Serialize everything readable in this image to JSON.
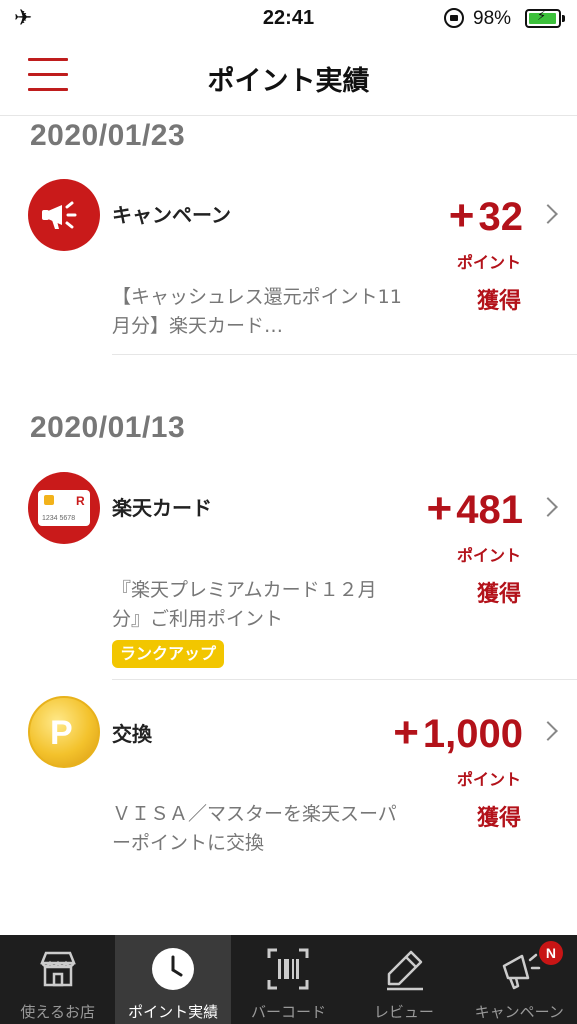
{
  "status_bar": {
    "time": "22:41",
    "battery_percent": "98%",
    "battery_level": 0.98,
    "icons": [
      "airplane-icon",
      "orientation-lock-icon",
      "battery-charging-icon"
    ]
  },
  "header": {
    "title": "ポイント実績",
    "menu_icon": "hamburger-icon"
  },
  "colors": {
    "accent_red": "#bf1d1d",
    "points_red": "#b3121a",
    "badge_yellow": "#f2c600",
    "tab_bar_bg": "#1e1e1e"
  },
  "groups": [
    {
      "date": "2020/01/23",
      "entries": [
        {
          "icon": "megaphone-icon",
          "category": "キャンペーン",
          "amount": "32",
          "plus": "+",
          "points_label": "ポイント",
          "status": "獲得",
          "description": "【キャッシュレス還元ポイント11月分】楽天カード…"
        }
      ]
    },
    {
      "date": "2020/01/13",
      "entries": [
        {
          "icon": "credit-card-icon",
          "category": "楽天カード",
          "amount": "481",
          "plus": "+",
          "points_label": "ポイント",
          "status": "獲得",
          "description": "『楽天プレミアムカード１２月分』ご利用ポイント",
          "badge": "ランクアップ",
          "card_number": "1234 5678",
          "card_brand": "R"
        },
        {
          "icon": "point-coin-icon",
          "category": "交換",
          "amount": "1,000",
          "plus": "+",
          "points_label": "ポイント",
          "status": "獲得",
          "description": "ＶＩＳＡ／マスターを楽天スーパーポイントに交換",
          "coin_letter": "P"
        }
      ]
    }
  ],
  "tab_bar": {
    "tabs": [
      {
        "label": "使えるお店",
        "icon": "store-icon",
        "active": false
      },
      {
        "label": "ポイント実績",
        "icon": "clock-icon",
        "active": true
      },
      {
        "label": "バーコード",
        "icon": "barcode-icon",
        "active": false
      },
      {
        "label": "レビュー",
        "icon": "pencil-icon",
        "active": false
      },
      {
        "label": "キャンペーン",
        "icon": "megaphone-icon",
        "active": false,
        "badge": "N"
      }
    ]
  }
}
